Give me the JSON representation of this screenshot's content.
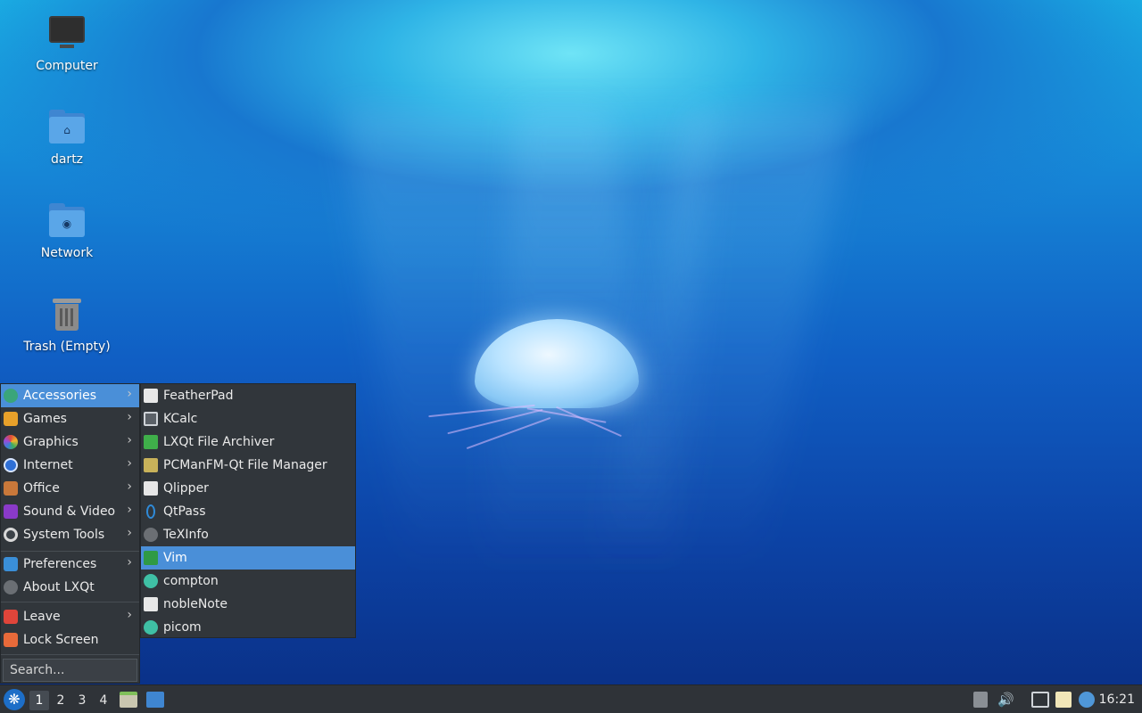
{
  "desktop": {
    "icons": [
      {
        "label": "Computer",
        "icon": "computer-icon"
      },
      {
        "label": "dartz",
        "icon": "home-folder-icon"
      },
      {
        "label": "Network",
        "icon": "network-folder-icon"
      },
      {
        "label": "Trash (Empty)",
        "icon": "trash-icon"
      }
    ]
  },
  "start_menu": {
    "categories": [
      {
        "label": "Accessories",
        "icon": "accessories-icon",
        "has_submenu": true,
        "active": true
      },
      {
        "label": "Games",
        "icon": "games-icon",
        "has_submenu": true
      },
      {
        "label": "Graphics",
        "icon": "graphics-icon",
        "has_submenu": true
      },
      {
        "label": "Internet",
        "icon": "internet-icon",
        "has_submenu": true
      },
      {
        "label": "Office",
        "icon": "office-icon",
        "has_submenu": true
      },
      {
        "label": "Sound & Video",
        "icon": "sound-video-icon",
        "has_submenu": true
      },
      {
        "label": "System Tools",
        "icon": "system-tools-icon",
        "has_submenu": true
      },
      {
        "label": "Preferences",
        "icon": "preferences-icon",
        "has_submenu": true
      },
      {
        "label": "About LXQt",
        "icon": "about-icon",
        "has_submenu": false
      },
      {
        "label": "Leave",
        "icon": "power-icon",
        "has_submenu": true
      },
      {
        "label": "Lock Screen",
        "icon": "lock-icon",
        "has_submenu": false
      }
    ],
    "search_placeholder": "Search...",
    "submenu_arrow": "›"
  },
  "accessories_submenu": {
    "items": [
      {
        "label": "FeatherPad",
        "icon": "featherpad-icon"
      },
      {
        "label": "KCalc",
        "icon": "kcalc-icon"
      },
      {
        "label": "LXQt File Archiver",
        "icon": "archiver-icon"
      },
      {
        "label": "PCManFM-Qt File Manager",
        "icon": "file-manager-icon"
      },
      {
        "label": "Qlipper",
        "icon": "qlipper-icon"
      },
      {
        "label": "QtPass",
        "icon": "qtpass-icon"
      },
      {
        "label": "TeXInfo",
        "icon": "texinfo-icon"
      },
      {
        "label": "Vim",
        "icon": "vim-icon",
        "active": true
      },
      {
        "label": "compton",
        "icon": "compton-icon"
      },
      {
        "label": "nobleNote",
        "icon": "noblenote-icon"
      },
      {
        "label": "picom",
        "icon": "picom-icon"
      }
    ]
  },
  "taskbar": {
    "workspaces": [
      "1",
      "2",
      "3",
      "4"
    ],
    "active_workspace": "1",
    "clock": "16:21"
  },
  "colors": {
    "menu_bg": "#31363b",
    "highlight": "#4a8fd8",
    "taskbar_bg": "#2f3338"
  }
}
